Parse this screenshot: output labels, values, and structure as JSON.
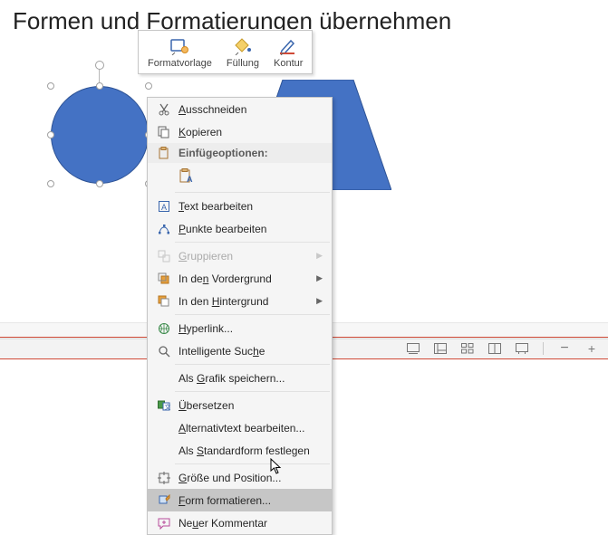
{
  "page_title": "Formen und Formatierungen übernehmen",
  "mini_toolbar": {
    "items": [
      {
        "label": "Formatvorlage"
      },
      {
        "label": "Füllung"
      },
      {
        "label": "Kontur"
      }
    ]
  },
  "shape_fill": "#4472c4",
  "shape_border": "#2e5395",
  "context_menu": {
    "cut": "Ausschneiden",
    "copy": "Kopieren",
    "paste_header": "Einfügeoptionen:",
    "edit_text": "Text bearbeiten",
    "edit_points": "Punkte bearbeiten",
    "group": "Gruppieren",
    "bring_front": "In den Vordergrund",
    "send_back": "In den Hintergrund",
    "hyperlink": "Hyperlink...",
    "smart_lookup": "Intelligente Suche",
    "save_graphic": "Als Grafik speichern...",
    "translate": "Übersetzen",
    "alt_text": "Alternativtext bearbeiten...",
    "set_default": "Als Standardform festlegen",
    "size_pos": "Größe und Position...",
    "format_shape": "Form formatieren...",
    "new_comment": "Neuer Kommentar"
  },
  "underline_chars": {
    "cut": "A",
    "copy": "K",
    "text": "T",
    "points": "P",
    "group": "G",
    "front": "n",
    "back": "H",
    "hyper": "H",
    "search": "h",
    "save": "G",
    "trans": "Ü",
    "alt": "A",
    "std": "S",
    "size": "G",
    "format": "F",
    "comment": "N"
  },
  "status": {
    "minus": "−",
    "plus": "+"
  }
}
